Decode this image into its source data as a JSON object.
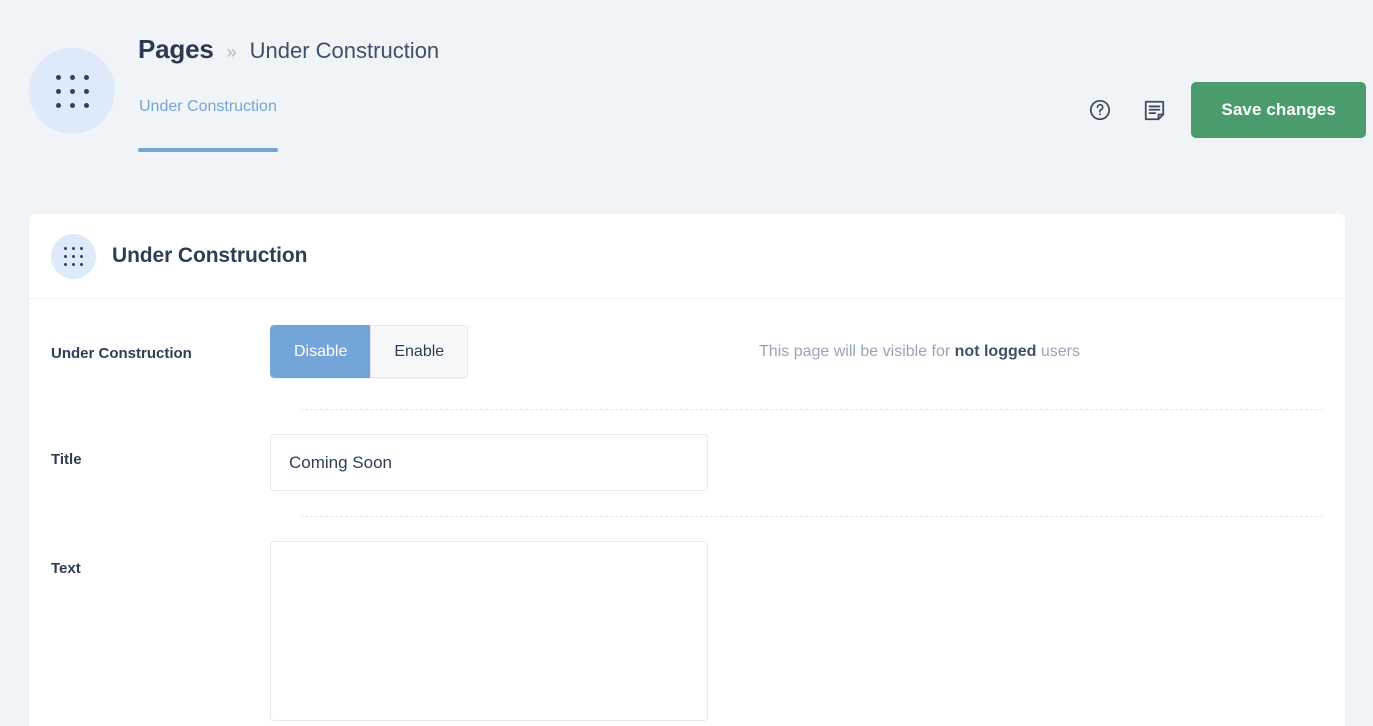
{
  "header": {
    "avatar_icon": "dot-grid-icon",
    "breadcrumb": {
      "root": "Pages",
      "separator": "»",
      "current": "Under Construction"
    },
    "tabs": [
      {
        "label": "Under Construction",
        "active": true
      }
    ],
    "actions": {
      "help_icon": "question-circle-icon",
      "notes_icon": "document-note-icon",
      "save_label": "Save changes"
    }
  },
  "card": {
    "icon": "dot-grid-icon",
    "title": "Under Construction",
    "rows": {
      "under_construction": {
        "label": "Under Construction",
        "options": [
          {
            "label": "Disable",
            "selected": true
          },
          {
            "label": "Enable",
            "selected": false
          }
        ],
        "hint_prefix": "This page will be visible for ",
        "hint_strong": "not logged",
        "hint_suffix": " users"
      },
      "title": {
        "label": "Title",
        "value": "Coming Soon",
        "placeholder": ""
      },
      "text": {
        "label": "Text",
        "value": "",
        "placeholder": ""
      }
    }
  },
  "colors": {
    "page_background": "#f1f4f7",
    "accent_blue": "#74a5d8",
    "accent_green": "#4a9c6c",
    "text_dark": "#2f3e56",
    "text_muted": "#98a4b6",
    "avatar_bg": "#ddeafa"
  }
}
